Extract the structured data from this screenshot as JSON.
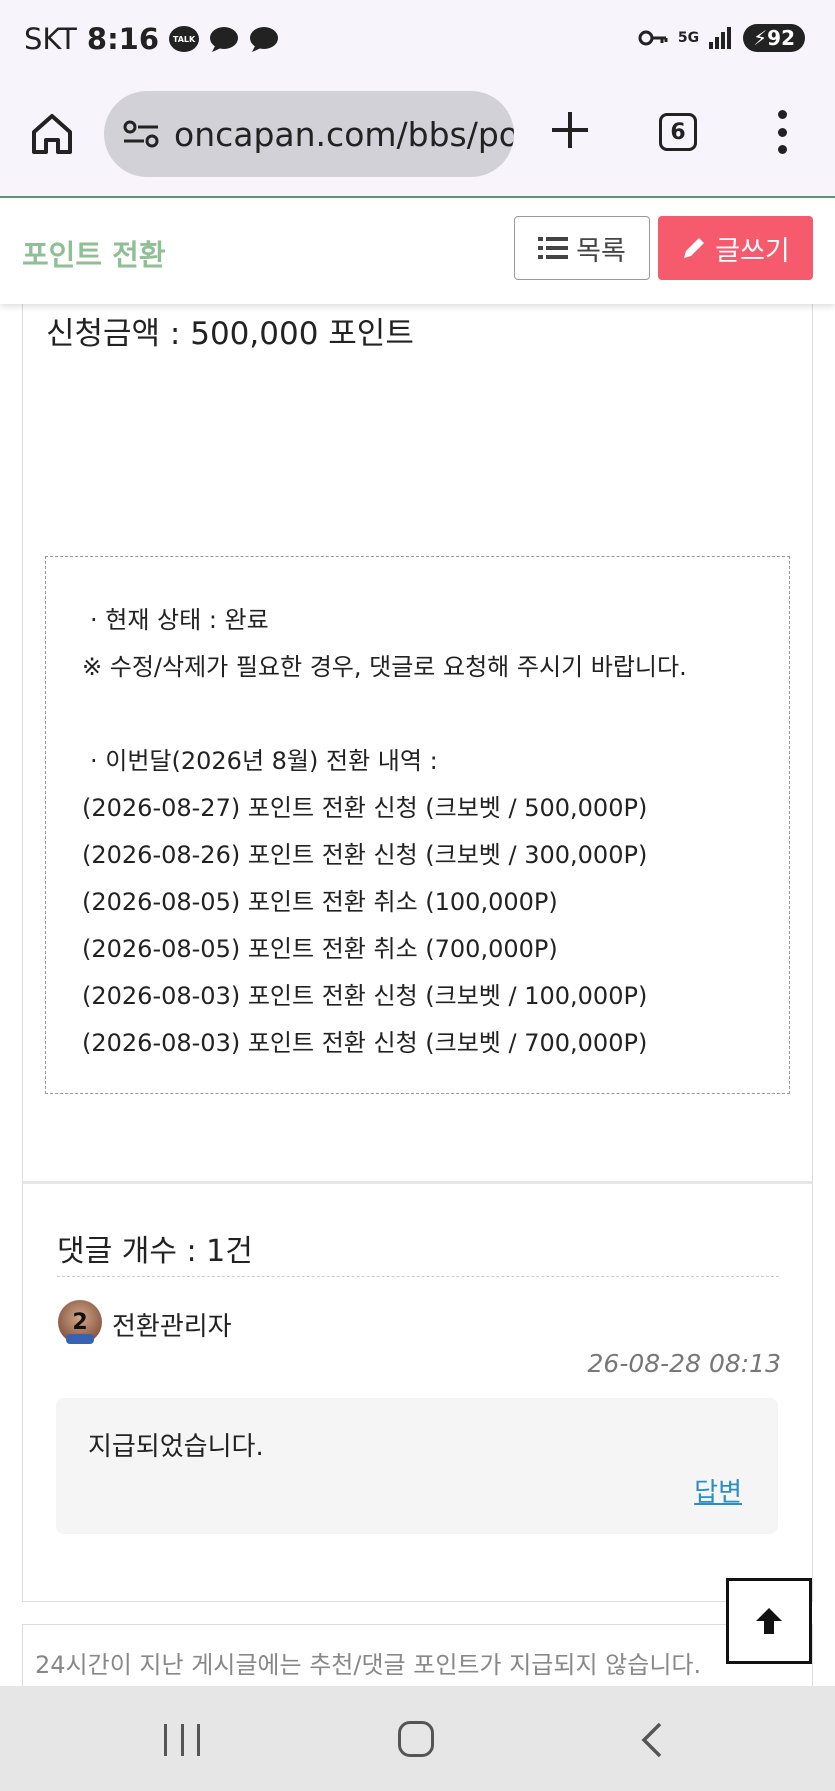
{
  "status_bar": {
    "carrier": "SKT",
    "time": "8:16",
    "talk_label": "TALK",
    "battery": "92",
    "network": "5G"
  },
  "browser": {
    "url": "oncapan.com/bbs/po",
    "tab_count": "6"
  },
  "header": {
    "board_title": "포인트 전환",
    "list_label": "목록",
    "write_label": "글쓰기"
  },
  "post": {
    "amount_line": "신청금액 : 500,000 포인트",
    "info_lines": [
      "·  현재 상태 : 완료",
      "※ 수정/삭제가 필요한 경우, 댓글로 요청해 주시기 바랍니다.",
      "",
      "·  이번달(2026년 8월) 전환 내역 :",
      "(2026-08-27) 포인트 전환 신청 (크보벳 / 500,000P)",
      "(2026-08-26) 포인트 전환 신청 (크보벳 / 300,000P)",
      "(2026-08-05) 포인트 전환 취소 (100,000P)",
      "(2026-08-05) 포인트 전환 취소 (700,000P)",
      "(2026-08-03) 포인트 전환 신청 (크보벳 / 100,000P)",
      "(2026-08-03) 포인트 전환 신청 (크보벳 / 700,000P)"
    ]
  },
  "comments": {
    "count_label": "댓글 개수 : 1건",
    "items": [
      {
        "avatar_level": "2",
        "author": "전환관리자",
        "date": "26-08-28 08:13",
        "text": "지급되었습니다.",
        "reply_label": "답변"
      }
    ]
  },
  "notice": "24시간이 지난 게시글에는 추천/댓글 포인트가 지급되지 않습니다.",
  "colors": {
    "board_title": "#8fbf95",
    "write_button": "#f55a6d",
    "reply_link": "#2a8fc6",
    "header_border": "#5a9a6e"
  }
}
